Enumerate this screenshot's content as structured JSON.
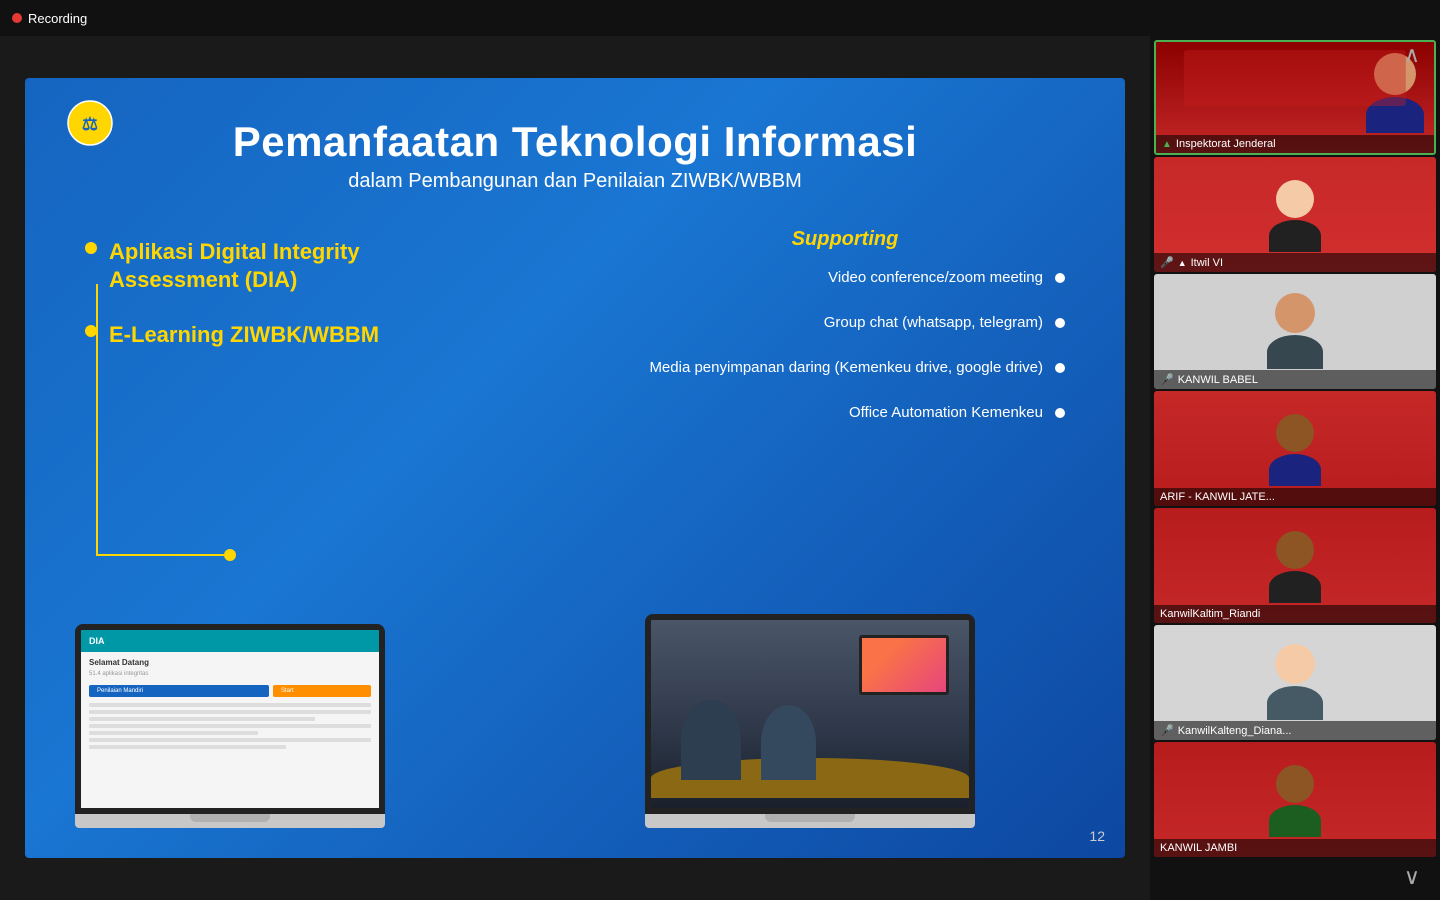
{
  "topbar": {
    "recording_label": "Recording"
  },
  "chevron_up": "∧",
  "chevron_down": "∨",
  "slide": {
    "title": "Pemanfaatan Teknologi Informasi",
    "subtitle": "dalam Pembangunan dan Penilaian ZIWBK/WBBM",
    "left_items": [
      {
        "text": "Aplikasi Digital Integrity Assessment (DIA)"
      },
      {
        "text": "E-Learning ZIWBK/WBBM"
      }
    ],
    "supporting_title": "Supporting",
    "support_items": [
      {
        "text": "Video conference/zoom meeting"
      },
      {
        "text": "Group chat (whatsapp, telegram)"
      },
      {
        "text": "Media penyimpanan daring (Kemenkeu drive, google drive)"
      },
      {
        "text": "Office Automation Kemenkeu"
      }
    ],
    "slide_number": "12"
  },
  "participants": [
    {
      "name": "Inspektorat Jenderal",
      "icons": "▲",
      "active": true,
      "tile_id": "tile-1"
    },
    {
      "name": "Itwil VI",
      "icons": "🎤 ▲",
      "active": false,
      "tile_id": "tile-2"
    },
    {
      "name": "KANWIL BABEL",
      "icons": "🎤",
      "active": false,
      "tile_id": "tile-3"
    },
    {
      "name": "ARIF - KANWIL JATE...",
      "icons": "",
      "active": false,
      "tile_id": "tile-4"
    },
    {
      "name": "KanwilKaltim_Riandi",
      "icons": "",
      "active": false,
      "tile_id": "tile-5"
    },
    {
      "name": "KanwilKalteng_Diana...",
      "icons": "🎤",
      "active": false,
      "tile_id": "tile-6"
    },
    {
      "name": "KANWIL JAMBI",
      "icons": "",
      "active": false,
      "tile_id": "tile-7"
    }
  ]
}
